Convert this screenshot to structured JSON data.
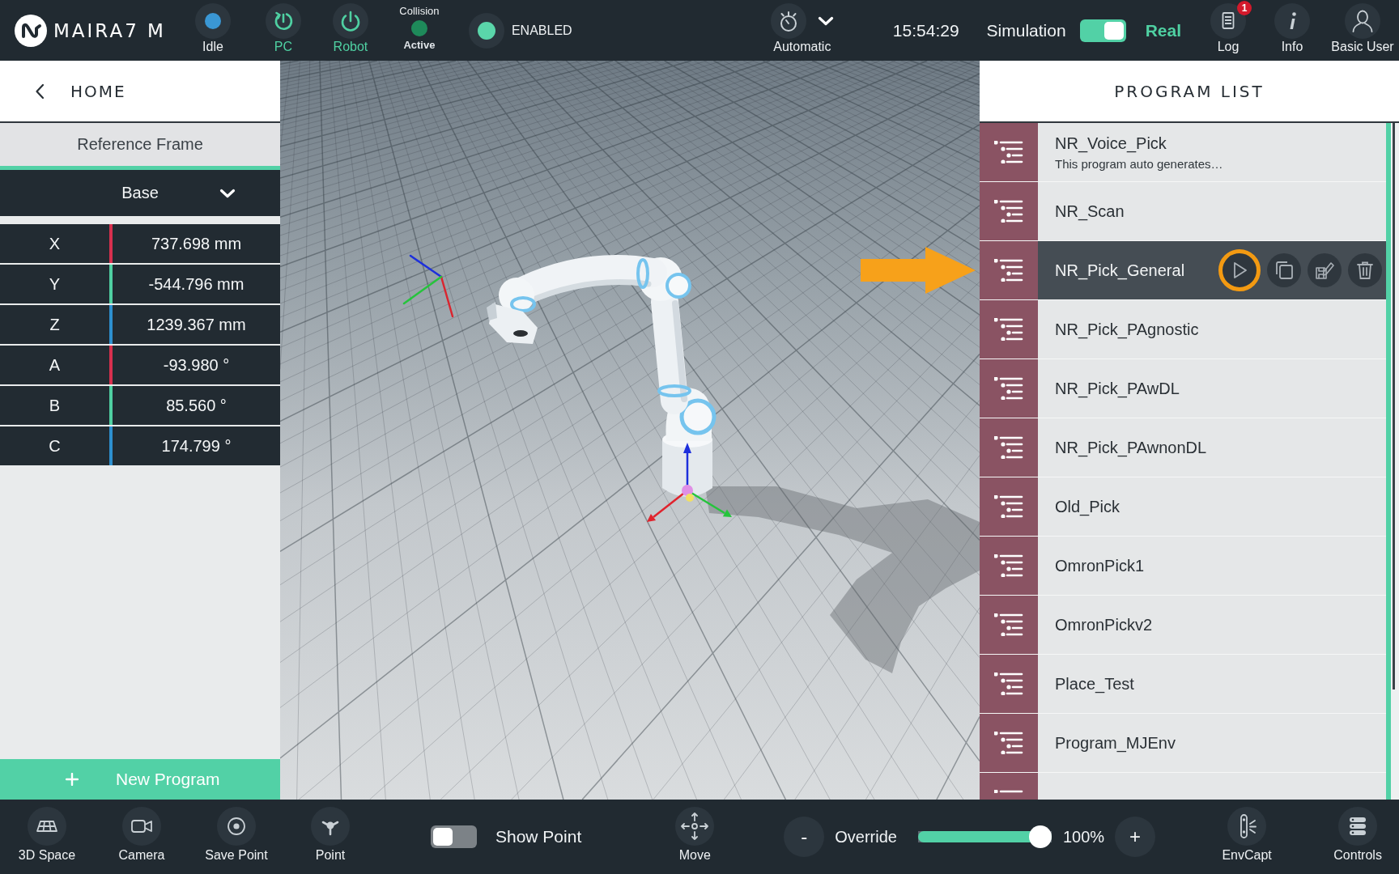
{
  "top_bar": {
    "logo": "MAIRA7 M",
    "status": [
      {
        "kind": "dot",
        "label": "Idle",
        "active": false,
        "color": "#3a97d4"
      },
      {
        "kind": "power_cycle",
        "label": "PC",
        "active": true
      },
      {
        "kind": "power",
        "label": "Robot",
        "active": true
      }
    ],
    "collision": {
      "title": "Collision",
      "label": "Active",
      "on": true
    },
    "drive": {
      "label": "ENABLED",
      "on": true
    },
    "mode": {
      "label": "Automatic"
    },
    "time": "15:54:29",
    "environment": {
      "left": "Simulation",
      "right": "Real",
      "on": true
    },
    "actions": [
      {
        "kind": "log",
        "label": "Log",
        "badge": "1"
      },
      {
        "kind": "info",
        "label": "Info"
      },
      {
        "kind": "user",
        "label": "Basic User"
      }
    ]
  },
  "left_panel": {
    "back": "HOME",
    "frame_title": "Reference Frame",
    "frame_value": "Base",
    "coordinates": [
      {
        "axis": "X",
        "value": "737.698 mm",
        "color": "#d8304e"
      },
      {
        "axis": "Y",
        "value": "-544.796 mm",
        "color": "#4fd0a2"
      },
      {
        "axis": "Z",
        "value": "1239.367 mm",
        "color": "#2d8fcf"
      },
      {
        "axis": "A",
        "value": "-93.980 °",
        "color": "#d8304e"
      },
      {
        "axis": "B",
        "value": "85.560 °",
        "color": "#4fd0a2"
      },
      {
        "axis": "C",
        "value": "174.799 °",
        "color": "#2d8fcf"
      }
    ],
    "new_program": "New Program"
  },
  "program_list": {
    "title": "PROGRAM LIST",
    "programs": [
      {
        "kind": "program",
        "name": "NR_Voice_Pick",
        "description": "This program auto generates…",
        "selected": false
      },
      {
        "kind": "program",
        "name": "NR_Scan",
        "selected": false
      },
      {
        "kind": "program",
        "name": "NR_Pick_General",
        "selected": true
      },
      {
        "kind": "program",
        "name": "NR_Pick_PAgnostic",
        "selected": false
      },
      {
        "kind": "program",
        "name": "NR_Pick_PAwDL",
        "selected": false
      },
      {
        "kind": "program",
        "name": "NR_Pick_PAwnonDL",
        "selected": false
      },
      {
        "kind": "program",
        "name": "Old_Pick",
        "selected": false
      },
      {
        "kind": "program",
        "name": "OmronPick1",
        "selected": false
      },
      {
        "kind": "program",
        "name": "OmronPickv2",
        "selected": false
      },
      {
        "kind": "program",
        "name": "Place_Test",
        "selected": false
      },
      {
        "kind": "program",
        "name": "Program_MJEnv",
        "selected": false
      },
      {
        "kind": "cut_off",
        "selected": false
      }
    ],
    "row_actions": [
      {
        "kind": "run",
        "highlighted": true
      },
      {
        "kind": "copy",
        "highlighted": false
      },
      {
        "kind": "save_edit",
        "highlighted": false
      },
      {
        "kind": "delete",
        "highlighted": false
      }
    ]
  },
  "bottom_bar": {
    "tools": [
      {
        "kind": "grid",
        "label": "3D Space"
      },
      {
        "kind": "camera",
        "label": "Camera"
      },
      {
        "kind": "target",
        "label": "Save Point"
      },
      {
        "kind": "point",
        "label": "Point"
      }
    ],
    "show_point": {
      "label": "Show Point",
      "on": false
    },
    "move": {
      "label": "Move"
    },
    "override": {
      "minus": "-",
      "label": "Override",
      "level": 1,
      "reading": "100%",
      "plus": "+"
    },
    "side_tools": [
      {
        "kind": "env_capture",
        "label": "EnvCapt"
      },
      {
        "kind": "controls",
        "label": "Controls"
      }
    ]
  }
}
